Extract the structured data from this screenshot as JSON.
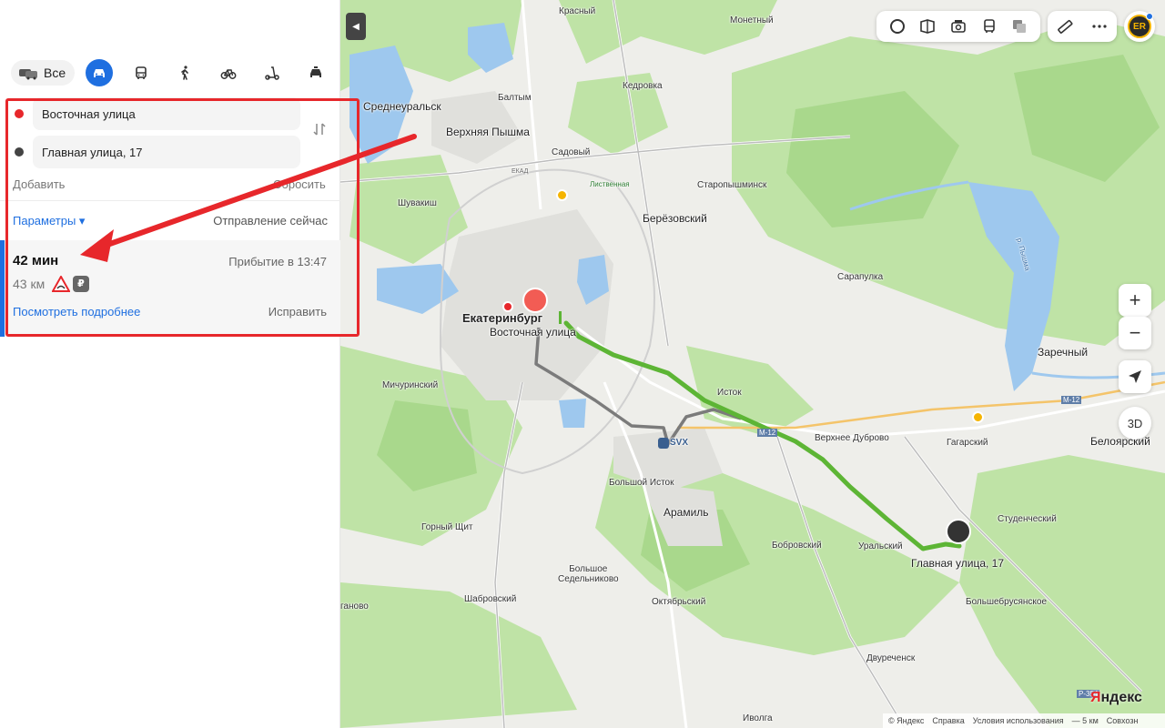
{
  "modes": {
    "all_label": "Все",
    "items": [
      "car",
      "bus",
      "walk",
      "bicycle",
      "scooter",
      "taxi"
    ],
    "active": "car"
  },
  "route": {
    "from": "Восточная улица",
    "to": "Главная улица, 17",
    "add_label": "Добавить",
    "reset_label": "Сбросить",
    "params_label": "Параметры ▾",
    "depart_label": "Отправление сейчас",
    "duration": "42 мин",
    "arrival": "Прибытие в 13:47",
    "distance": "43 км",
    "details_label": "Посмотреть подробнее",
    "fix_label": "Исправить"
  },
  "toolbar": {
    "icons": [
      "layers-icon",
      "panorama-icon",
      "photo-icon",
      "transit-icon",
      "layers-stack-icon"
    ],
    "right_icons": [
      "ruler-icon",
      "more-icon"
    ],
    "avatar_initials": "ER"
  },
  "map": {
    "labels": {
      "krasny": "Красный",
      "monetny": "Монетный",
      "sredneuralsk": "Среднеуральск",
      "baltym": "Балтым",
      "kedrovka": "Кедровка",
      "vpyshma": "Верхняя Пышма",
      "sadovy": "Садовый",
      "listvennaya": "Лиственная",
      "staropyshminsk": "Старопышминск",
      "shuvakish": "Шувакиш",
      "berezovsky": "Берёзовский",
      "sarapulka": "Сарапулка",
      "zarechny": "Заречный",
      "pyshma_river": "р. Пышма",
      "ekaterinburg": "Екатеринбург",
      "vostochnaya": "Восточная улица",
      "michurinsky": "Мичуринский",
      "istok": "Исток",
      "vdubrovo": "Верхнее Дуброво",
      "gagarsky": "Гагарский",
      "belojarsky": "Белоярский",
      "svx": "SVX",
      "bistok": "Большой Исток",
      "aramil": "Арамиль",
      "gorny": "Горный Щит",
      "studenchesky": "Студенческий",
      "bobrovsky": "Бобровский",
      "uralsky": "Уральский",
      "glavnaya": "Главная улица, 17",
      "bsedelnikovo": "Большое\nСедельниково",
      "shabrovsky": "Шабровский",
      "oktyabrsky": "Октябрьский",
      "bolshebrusyanskoe": "Большебрусянское",
      "dvurechensk": "Двуреченск",
      "ivolga": "Иволга",
      "aganovo": "ганово",
      "m12": "М-12",
      "r354": "Р-354",
      "ekad": "ЕКАД"
    },
    "zoom_in": "+",
    "zoom_out": "−",
    "btn_3d": "3D",
    "brand": "Яндекс",
    "footer": [
      "© Яндекс",
      "Справка",
      "Условия использования",
      "— 5 км",
      "Совхозн"
    ]
  }
}
